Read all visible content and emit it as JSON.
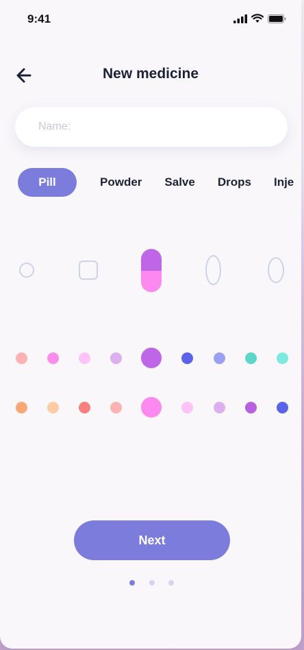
{
  "status_bar": {
    "time": "9:41"
  },
  "header": {
    "title": "New medicine"
  },
  "name_input": {
    "placeholder": "Name:",
    "value": ""
  },
  "type_tabs": [
    {
      "label": "Pill",
      "selected": true
    },
    {
      "label": "Powder",
      "selected": false
    },
    {
      "label": "Salve",
      "selected": false
    },
    {
      "label": "Drops",
      "selected": false
    },
    {
      "label": "Inje",
      "selected": false
    }
  ],
  "shapes": {
    "options": [
      "circle",
      "square",
      "capsule",
      "oval-tall",
      "oval"
    ],
    "selected": "capsule",
    "capsule_colors": [
      "#be66e6",
      "#fb89ef"
    ]
  },
  "colors": {
    "row1": [
      "#fbb2b0",
      "#fb8ded",
      "#fdc2f6",
      "#dcafee",
      "#be66e6",
      "#5c63e8",
      "#9aa1f2",
      "#5bd6c8",
      "#7de9df"
    ],
    "row1_selected": 4,
    "row2": [
      "#f9a874",
      "#fdcca7",
      "#fb7f7f",
      "#fbb2b0",
      "#fb89ef",
      "#fdc2f6",
      "#dcafee",
      "#b960e0",
      "#5c63e8"
    ],
    "row2_selected": 4
  },
  "next_button": {
    "label": "Next"
  },
  "pagination": {
    "total": 3,
    "current": 1,
    "active_color": "#7b7cdb",
    "inactive_color": "#d3d4f2"
  }
}
